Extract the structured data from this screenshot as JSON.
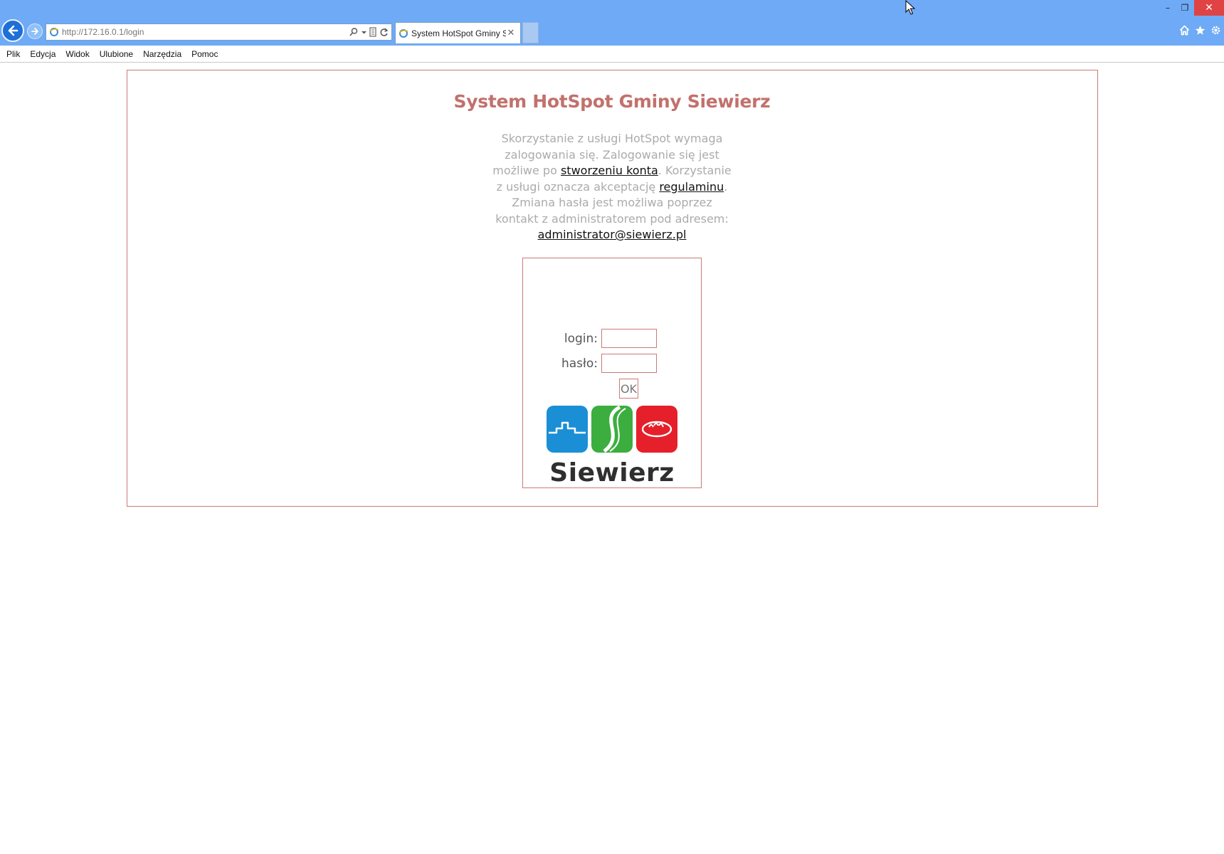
{
  "browser": {
    "url": "http://172.16.0.1/login",
    "tab_title": "System HotSpot Gminy Sie...",
    "tab_close": "✕",
    "menu": [
      "Plik",
      "Edycja",
      "Widok",
      "Ulubione",
      "Narzędzia",
      "Pomoc"
    ],
    "window_controls": {
      "minimize": "–",
      "maximize": "❐",
      "close": "✕"
    },
    "icons": [
      "back-arrow-icon",
      "forward-arrow-icon",
      "ie-icon",
      "search-icon",
      "compat-view-icon",
      "refresh-icon",
      "home-icon",
      "favorites-star-icon",
      "settings-gear-icon"
    ]
  },
  "page": {
    "title": "System HotSpot Gminy Siewierz",
    "intro": {
      "text1": "Skorzystanie z usługi HotSpot wymaga zalogowania się. Zalogowanie się jest możliwe po ",
      "link1": "stworzeniu konta",
      "text2": ". Korzystanie z usługi oznacza akceptację ",
      "link2": "regulaminu",
      "text3": ". Zmiana hasła jest możliwa poprzez kontakt z administratorem pod adresem: ",
      "email": "administrator@siewierz.pl"
    },
    "form": {
      "login_label": "login:",
      "login_value": "",
      "password_label": "hasło:",
      "password_value": "",
      "submit_label": "OK"
    },
    "logo": {
      "text": "Siewierz",
      "colors": {
        "blue": "#1a8fd6",
        "green": "#3cae3f",
        "red": "#e5202a"
      }
    }
  },
  "colors": {
    "chrome_blue": "#6eaaf5",
    "accent": "#c2716c",
    "border": "#c97a76",
    "muted_text": "#ababab"
  }
}
